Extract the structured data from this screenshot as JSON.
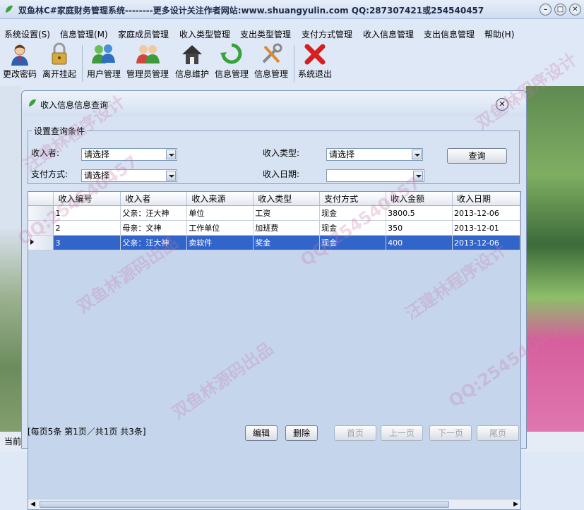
{
  "app": {
    "title": "双鱼林C#家庭财务管理系统--------更多设计关注作者网站:www.shuangyulin.com   QQ:287307421或254540457",
    "window_buttons": [
      "–",
      "□",
      "✕"
    ]
  },
  "menu": [
    "系统设置(S)",
    "信息管理(M)",
    "家庭成员管理",
    "收入类型管理",
    "支出类型管理",
    "支付方式管理",
    "收入信息管理",
    "支出信息管理",
    "帮助(H)"
  ],
  "toolbar": [
    {
      "label": "更改密码",
      "icon": "user-key-icon"
    },
    {
      "label": "离开挂起",
      "icon": "padlock-icon"
    },
    {
      "label": "用户管理",
      "icon": "users-icon"
    },
    {
      "label": "管理员管理",
      "icon": "admins-icon"
    },
    {
      "label": "信息维护",
      "icon": "home-icon"
    },
    {
      "label": "信息管理",
      "icon": "recycle-icon"
    },
    {
      "label": "信息管理",
      "icon": "tools-icon"
    },
    {
      "label": "系统退出",
      "icon": "red-x-icon"
    }
  ],
  "dialog": {
    "title": "收入信息信息查询",
    "close": "✕",
    "conditions": {
      "legend": "设置查询条件",
      "income_person_label": "收入者:",
      "income_person_value": "请选择",
      "income_type_label": "收入类型:",
      "income_type_value": "请选择",
      "pay_method_label": "支付方式:",
      "pay_method_value": "请选择",
      "income_date_label": "收入日期:",
      "income_date_value": "",
      "query_button": "查询"
    },
    "table": {
      "columns": [
        "收入编号",
        "收入者",
        "收入来源",
        "收入类型",
        "支付方式",
        "收入金额",
        "收入日期"
      ],
      "rows": [
        [
          "1",
          "父亲：汪大神",
          "单位",
          "工资",
          "现金",
          "3800.5",
          "2013-12-06"
        ],
        [
          "2",
          "母亲：文神",
          "工作单位",
          "加班费",
          "现金",
          "350",
          "2013-12-01"
        ],
        [
          "3",
          "父亲：汪大神",
          "卖软件",
          "奖金",
          "现金",
          "400",
          "2013-12-06"
        ]
      ],
      "selected_row": 2
    },
    "paging": {
      "info": "[每页5条  第1页／共1页    共3条]",
      "edit": "编辑",
      "delete": "删除",
      "first": "首页",
      "prev": "上一页",
      "next": "下一页",
      "last": "尾页"
    }
  },
  "status": {
    "text": "当前"
  },
  "watermarks": [
    "双鱼林源码出品",
    "QQ:254540457",
    "汪建林程序设计",
    "双鱼林源码出品",
    "QQ:254540457",
    "汪建林程序设计",
    "双鱼林程序设计",
    "QQ:254540457"
  ]
}
